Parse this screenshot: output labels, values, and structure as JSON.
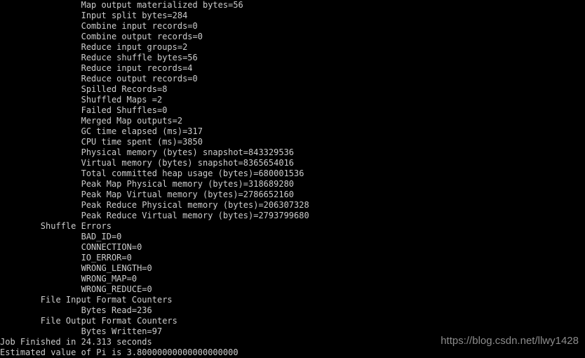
{
  "terminal": {
    "background_color": "#000000",
    "text_color": "#cccccc",
    "lines": [
      "                Map output materialized bytes=56",
      "                Input split bytes=284",
      "                Combine input records=0",
      "                Combine output records=0",
      "                Reduce input groups=2",
      "                Reduce shuffle bytes=56",
      "                Reduce input records=4",
      "                Reduce output records=0",
      "                Spilled Records=8",
      "                Shuffled Maps =2",
      "                Failed Shuffles=0",
      "                Merged Map outputs=2",
      "                GC time elapsed (ms)=317",
      "                CPU time spent (ms)=3850",
      "                Physical memory (bytes) snapshot=843329536",
      "                Virtual memory (bytes) snapshot=8365654016",
      "                Total committed heap usage (bytes)=680001536",
      "                Peak Map Physical memory (bytes)=318689280",
      "                Peak Map Virtual memory (bytes)=2786652160",
      "                Peak Reduce Physical memory (bytes)=206307328",
      "                Peak Reduce Virtual memory (bytes)=2793799680",
      "        Shuffle Errors",
      "                BAD_ID=0",
      "                CONNECTION=0",
      "                IO_ERROR=0",
      "                WRONG_LENGTH=0",
      "                WRONG_MAP=0",
      "                WRONG_REDUCE=0",
      "        File Input Format Counters",
      "                Bytes Read=236",
      "        File Output Format Counters",
      "                Bytes Written=97",
      "Job Finished in 24.313 seconds",
      "Estimated value of Pi is 3.80000000000000000000"
    ]
  },
  "watermark": {
    "text": "https://blog.csdn.net/llwy1428",
    "color": "#8c8c8c"
  }
}
